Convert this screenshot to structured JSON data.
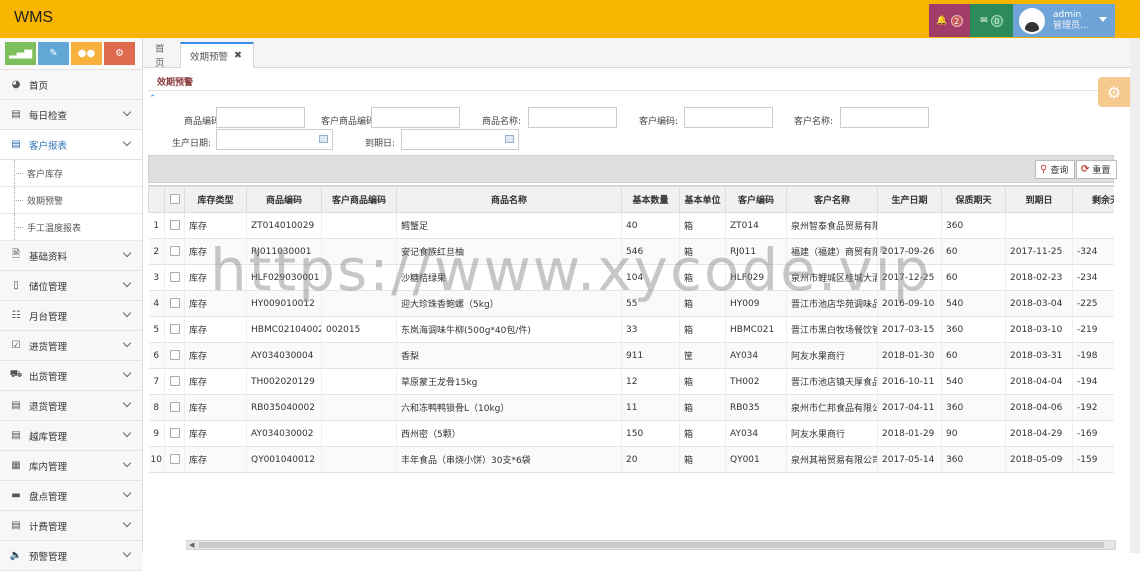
{
  "header": {
    "brand": "WMS",
    "notifications_count": "2",
    "messages_count": "0",
    "user_name": "admin",
    "user_role": "管理员..."
  },
  "sidebar": {
    "items": [
      {
        "label": "首页",
        "icon": "dashboard-icon"
      },
      {
        "label": "每日检查",
        "icon": "list-icon"
      },
      {
        "label": "客户报表",
        "icon": "list-icon"
      },
      {
        "label": "基础资料",
        "icon": "file-icon"
      },
      {
        "label": "储位管理",
        "icon": "phone-icon"
      },
      {
        "label": "月台管理",
        "icon": "grid-list-icon"
      },
      {
        "label": "进货管理",
        "icon": "checkbox-icon"
      },
      {
        "label": "出货管理",
        "icon": "truck-icon"
      },
      {
        "label": "退货管理",
        "icon": "list-icon"
      },
      {
        "label": "越库管理",
        "icon": "list-icon"
      },
      {
        "label": "库内管理",
        "icon": "film-icon"
      },
      {
        "label": "盘点管理",
        "icon": "drive-icon"
      },
      {
        "label": "计费管理",
        "icon": "list-icon"
      },
      {
        "label": "预警管理",
        "icon": "volume-icon"
      }
    ],
    "subitems": [
      "客户库存",
      "效期预警",
      "手工温度报表"
    ]
  },
  "tabs": {
    "home": "首页",
    "active": "效期预警",
    "close": "✖"
  },
  "panel": {
    "title": "效期预警"
  },
  "form": {
    "product_code": "商品编码:",
    "customer_product_code": "客户商品编码:",
    "product_name": "商品名称:",
    "customer_code": "客户编码:",
    "customer_name": "客户名称:",
    "production_date": "生产日期:",
    "expiry_date": "到期日:"
  },
  "toolbar": {
    "search": "查询",
    "reset": "重置"
  },
  "table": {
    "columns": [
      "",
      "",
      "库存类型",
      "商品编码",
      "客户商品编码",
      "商品名称",
      "基本数量",
      "基本单位",
      "客户编码",
      "客户名称",
      "生产日期",
      "保质期天",
      "到期日",
      "剩余天"
    ],
    "rows": [
      [
        "1",
        "库存",
        "ZT014010029",
        "",
        "鳕蟹足",
        "40",
        "箱",
        "ZT014",
        "泉州智泰食品贸易有限",
        "",
        "360",
        "",
        ""
      ],
      [
        "2",
        "库存",
        "RJ011030001",
        "",
        "安记食族红旦柚",
        "546",
        "箱",
        "RJ011",
        "福建（福建）商贸有限",
        "2017-09-26",
        "60",
        "2017-11-25",
        "-324"
      ],
      [
        "3",
        "库存",
        "HLF029030001",
        "",
        "沙糖桔绿果",
        "104",
        "箱",
        "HLF029",
        "泉州市鲤城区桂城大酒",
        "2017-12-25",
        "60",
        "2018-02-23",
        "-234"
      ],
      [
        "4",
        "库存",
        "HY009010012",
        "",
        "迎大珍珠香鲍螺（5kg）",
        "55",
        "箱",
        "HY009",
        "晋江市池店华苑调味品",
        "2016-09-10",
        "540",
        "2018-03-04",
        "-225"
      ],
      [
        "5",
        "库存",
        "HBMC0210400201",
        "002015",
        "东岚海调味牛柳(500g*40包/件)",
        "33",
        "箱",
        "HBMC021",
        "晋江市黑白牧场餐饮管",
        "2017-03-15",
        "360",
        "2018-03-10",
        "-219"
      ],
      [
        "6",
        "库存",
        "AY034030004",
        "",
        "香梨",
        "911",
        "筐",
        "AY034",
        "阿友水果商行",
        "2018-01-30",
        "60",
        "2018-03-31",
        "-198"
      ],
      [
        "7",
        "库存",
        "TH002020129",
        "",
        "草原蒙王龙骨15kg",
        "12",
        "箱",
        "TH002",
        "晋江市池店镇天厚食品",
        "2016-10-11",
        "540",
        "2018-04-04",
        "-194"
      ],
      [
        "8",
        "库存",
        "RB035040002",
        "",
        "六和冻鸭鸭锁骨L（10kg）",
        "11",
        "箱",
        "RB035",
        "泉州市仁邦食品有限公",
        "2017-04-11",
        "360",
        "2018-04-06",
        "-192"
      ],
      [
        "9",
        "库存",
        "AY034030002",
        "",
        "西州密（5颗）",
        "150",
        "箱",
        "AY034",
        "阿友水果商行",
        "2018-01-29",
        "90",
        "2018-04-29",
        "-169"
      ],
      [
        "10",
        "库存",
        "QY001040012",
        "",
        "丰年食品（串烧小饼）30支*6袋",
        "20",
        "箱",
        "QY001",
        "泉州其裕贸易有限公司",
        "2017-05-14",
        "360",
        "2018-05-09",
        "-159"
      ]
    ]
  },
  "watermark": "https://www.xycode.vip"
}
